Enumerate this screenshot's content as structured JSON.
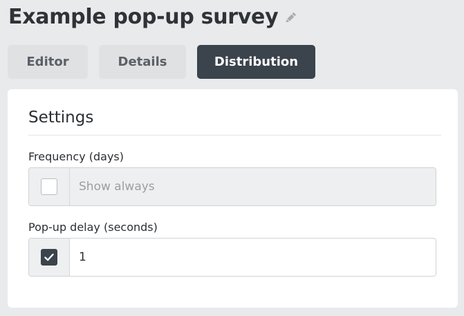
{
  "header": {
    "title": "Example pop-up survey",
    "edit_icon": "pencil-icon"
  },
  "tabs": [
    {
      "label": "Editor",
      "active": false
    },
    {
      "label": "Details",
      "active": false
    },
    {
      "label": "Distribution",
      "active": true
    }
  ],
  "settings": {
    "title": "Settings",
    "frequency": {
      "label": "Frequency (days)",
      "checkbox_checked": false,
      "value": "",
      "placeholder": "Show always",
      "disabled": true
    },
    "delay": {
      "label": "Pop-up delay (seconds)",
      "checkbox_checked": true,
      "value": "1",
      "placeholder": ""
    }
  },
  "colors": {
    "page_bg": "#e9eaec",
    "active_tab": "#3b434c",
    "inactive_tab": "#dfe1e3",
    "card_bg": "#ffffff"
  }
}
